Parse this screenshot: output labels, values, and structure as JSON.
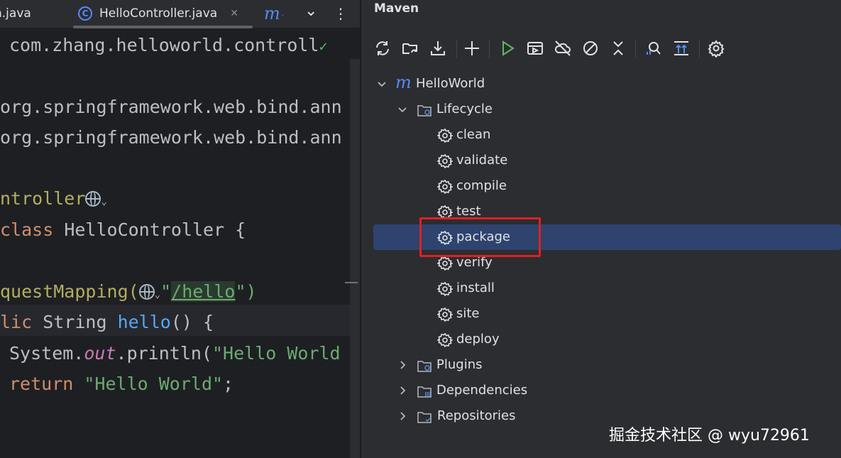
{
  "editor": {
    "tabs": [
      {
        "label": "n.java"
      },
      {
        "label": "HelloController.java",
        "icon": "class-c-icon",
        "close": "✕"
      },
      {
        "label": "m",
        "icon": "maven-icon"
      }
    ],
    "tab_overflow": "⌄",
    "tab_menu": "⋮",
    "lines": {
      "package": "com.zhang.helloworld.controll",
      "import1": "org.springframework.web.bind.ann",
      "import2": "org.springframework.web.bind.ann",
      "annotation": "ntroller",
      "class_kw": "class",
      "class_name": "HelloController {",
      "mapping": "questMapping(",
      "mapping_str_open": "\"",
      "mapping_path": "/hello",
      "mapping_str_close": "\")",
      "method_kw": "lic",
      "method_type": "String",
      "method_name": "hello",
      "method_rest": "() {",
      "sysout_obj": "System.",
      "sysout_field": "out",
      "sysout_call": ".println(",
      "sysout_str": "\"Hello World",
      "return_kw": "return",
      "return_str": "\"Hello World\"",
      "return_end": ";"
    }
  },
  "maven": {
    "title": "Maven",
    "toolbar": [
      "reload-icon",
      "reload-folder-icon",
      "download-icon",
      "add-icon",
      "run-icon",
      "run-config-icon",
      "offline-icon",
      "skip-tests-icon",
      "collapse-icon",
      "analyze-icon",
      "show-deps-icon",
      "settings-icon"
    ],
    "tree": {
      "root": "HelloWorld",
      "lifecycle": "Lifecycle",
      "phases": [
        "clean",
        "validate",
        "compile",
        "test",
        "package",
        "verify",
        "install",
        "site",
        "deploy"
      ],
      "selected": "package",
      "plugins": "Plugins",
      "dependencies": "Dependencies",
      "repositories": "Repositories"
    }
  },
  "watermark": "掘金技术社区 @ wyu72961",
  "colors": {
    "selection": "#2e436e",
    "highlight_box": "#e02020",
    "accent_blue": "#548af7",
    "run_green": "#5fb865"
  }
}
